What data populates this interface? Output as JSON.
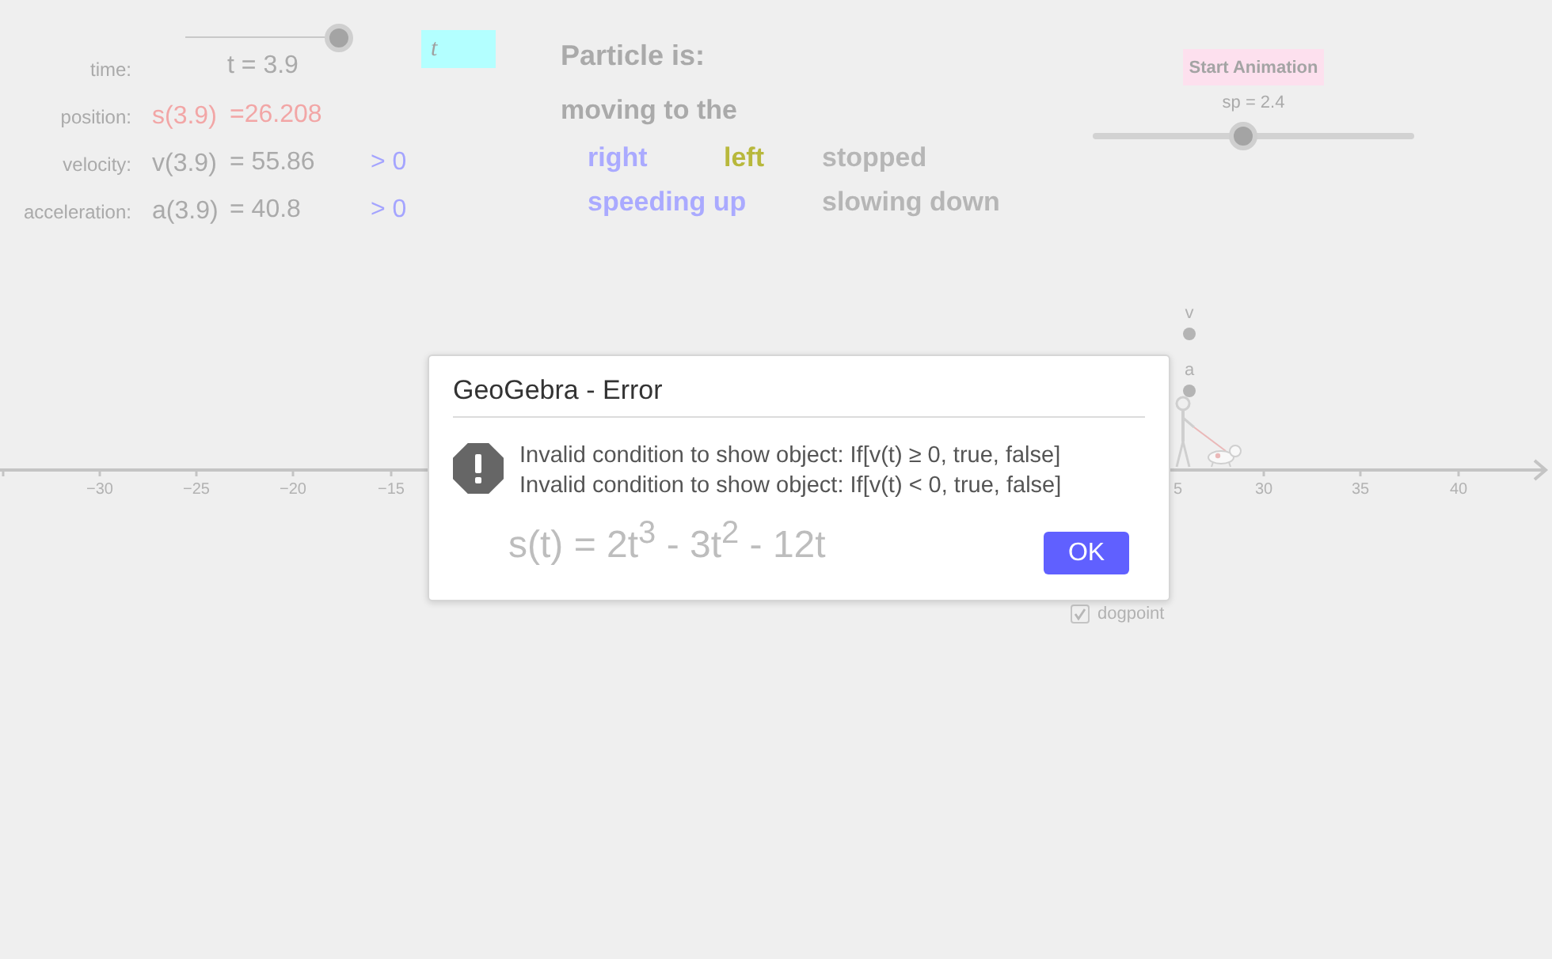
{
  "applet": {
    "time_slider": {
      "level": 0.99,
      "label": "t = 3.9"
    },
    "time_label": "time:",
    "input_box": {
      "value": "t"
    },
    "quantities": [
      {
        "label": "position:",
        "expression": "s(3.9)",
        "value": "=26.208",
        "color": "#f2a6a6"
      },
      {
        "label": "velocity:",
        "expression": "v(3.9)",
        "value": "= 55.86",
        "sign": "> 0",
        "color": "#aaaaaa"
      },
      {
        "label": "acceleration:",
        "expression": "a(3.9)",
        "value": "= 40.8",
        "sign": "> 0",
        "color": "#aaaaaa"
      }
    ],
    "particle": {
      "title": "Particle is:",
      "heading": "moving to the",
      "directions": [
        {
          "label": "right",
          "color": "#aaaaff"
        },
        {
          "label": "left",
          "color": "#b8b83c"
        },
        {
          "label": "stopped",
          "color": "#b6b6b6"
        }
      ],
      "changes": [
        {
          "label": "speeding up",
          "color": "#aaaaff"
        },
        {
          "label": "slowing down",
          "color": "#b6b6b6"
        }
      ]
    },
    "animation": {
      "button": "Start Animation",
      "speed_slider": {
        "label": "sp = 2.4",
        "level": 0.47
      }
    },
    "number_line": {
      "tick_labels": [
        "−30",
        "−25",
        "−20",
        "−15",
        "5",
        "30",
        "35",
        "40"
      ],
      "points": [
        {
          "label": "v"
        },
        {
          "label": "a"
        }
      ]
    },
    "formula": "s(t) = 2t$^{3}$ - 3t$^{2}$ - 12t",
    "checkbox": {
      "label": "dogpoint",
      "checked": true
    }
  },
  "dialog": {
    "title": "GeoGebra - Error",
    "messages": [
      "Invalid condition to show object: If[v(t) ≥ 0, true, false]",
      "Invalid condition to show object: If[v(t) < 0, true, false]"
    ],
    "button": "OK"
  }
}
